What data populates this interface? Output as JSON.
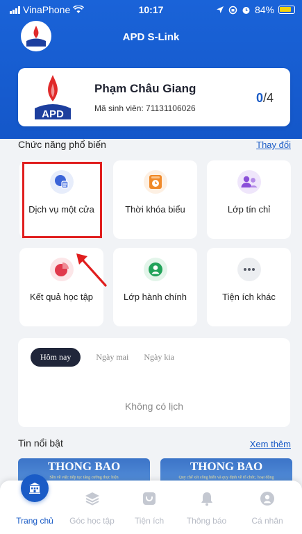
{
  "status_bar": {
    "carrier": "VinaPhone",
    "time": "10:17",
    "battery": "84%"
  },
  "app": {
    "title": "APD S-Link",
    "logo_text": "APD"
  },
  "profile": {
    "name": "Phạm Châu Giang",
    "student_id_label": "Mã sinh viên: 71131106026",
    "count_current": "0",
    "count_total": "/4"
  },
  "features": {
    "title": "Chức năng phổ biến",
    "change_link": "Thay đổi",
    "items": [
      {
        "label": "Dịch vụ một cửa",
        "icon": "one-stop-service-icon",
        "color": "#3b64d8",
        "bg": "#e7edfb"
      },
      {
        "label": "Thời khóa biểu",
        "icon": "timetable-icon",
        "color": "#f08a2a",
        "bg": "#fdf0e3"
      },
      {
        "label": "Lớp tín chỉ",
        "icon": "credit-class-icon",
        "color": "#8a4fd8",
        "bg": "#efe6fb"
      },
      {
        "label": "Kết quả học tập",
        "icon": "study-results-icon",
        "color": "#e03a4c",
        "bg": "#fce6e8"
      },
      {
        "label": "Lớp hành chính",
        "icon": "admin-class-icon",
        "color": "#22a35a",
        "bg": "#e3f5ea"
      },
      {
        "label": "Tiện ích khác",
        "icon": "more-utilities-icon",
        "color": "#555a66",
        "bg": "#eceef1"
      }
    ]
  },
  "schedule": {
    "tabs": [
      "Hôm nay",
      "Ngày mai",
      "Ngày kia"
    ],
    "active_tab": 0,
    "empty_text": "Không có lịch"
  },
  "news": {
    "title": "Tin nổi bật",
    "more_link": "Xem thêm",
    "items": [
      {
        "heading": "THONG BAO",
        "subtitle": "Sền về việc tiếp tục tăng cường thực hiện"
      },
      {
        "heading": "THONG BAO",
        "subtitle": "Quy chế xét công hiến và quy định về tổ chức, hoạt động"
      }
    ]
  },
  "bottom_nav": {
    "active": 0,
    "items": [
      {
        "label": "Trang chủ",
        "icon": "home-icon"
      },
      {
        "label": "Góc học tập",
        "icon": "layers-icon"
      },
      {
        "label": "Tiện ích",
        "icon": "utilities-icon"
      },
      {
        "label": "Thông báo",
        "icon": "bell-icon"
      },
      {
        "label": "Cá nhân",
        "icon": "user-icon"
      }
    ]
  },
  "colors": {
    "primary": "#1a5bc6",
    "highlight": "#e01e1e",
    "background": "#f1f3f6"
  }
}
